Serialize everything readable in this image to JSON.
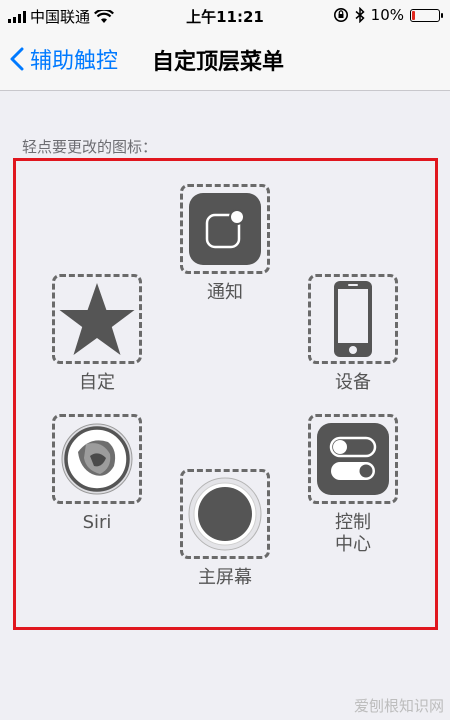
{
  "status_bar": {
    "carrier": "中国联通",
    "time": "上午11:21",
    "battery_percent": "10%",
    "battery_level": 0.1
  },
  "nav": {
    "back_label": "辅助触控",
    "title": "自定顶层菜单"
  },
  "section_label": "轻点要更改的图标：",
  "items": {
    "notification": "通知",
    "custom": "自定",
    "device": "设备",
    "siri": "Siri",
    "control_center": "控制\n中心",
    "home": "主屏幕"
  },
  "watermark": "爱刨根知识网",
  "colors": {
    "accent": "#007aff",
    "highlight_border": "#e0161e",
    "icon_gray": "#555555",
    "battery_low": "#e0281e"
  }
}
